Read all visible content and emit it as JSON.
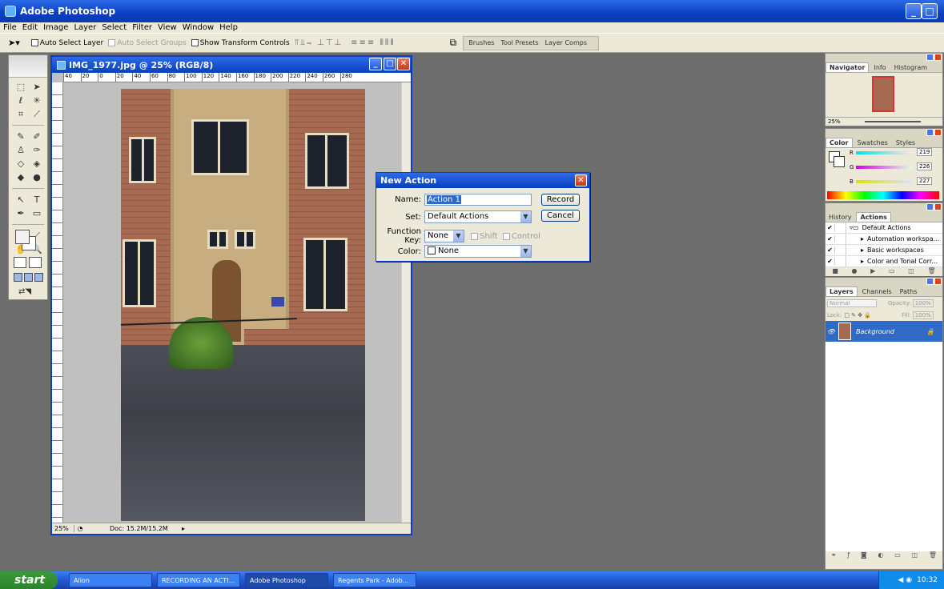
{
  "app": {
    "title": "Adobe Photoshop"
  },
  "menu": [
    "File",
    "Edit",
    "Image",
    "Layer",
    "Select",
    "Filter",
    "View",
    "Window",
    "Help"
  ],
  "options": {
    "auto_select_layer": "Auto Select Layer",
    "auto_select_groups": "Auto Select Groups",
    "show_transform": "Show Transform Controls",
    "palette_well_tabs": [
      "Brushes",
      "Tool Presets",
      "Layer Comps"
    ]
  },
  "document": {
    "title": "IMG_1977.jpg @ 25% (RGB/8)",
    "ruler_ticks": [
      "40",
      "20",
      "0",
      "20",
      "40",
      "60",
      "80",
      "100",
      "120",
      "140",
      "160",
      "180",
      "200",
      "220",
      "240",
      "260",
      "280"
    ],
    "zoom": "25%",
    "doc_size": "Doc: 15.2M/15.2M"
  },
  "dialog": {
    "title": "New Action",
    "name_label": "Name:",
    "name_value": "Action 1",
    "set_label": "Set:",
    "set_value": "Default Actions",
    "fkey_label": "Function Key:",
    "fkey_value": "None",
    "shift_label": "Shift",
    "control_label": "Control",
    "color_label": "Color:",
    "color_value": "None",
    "record": "Record",
    "cancel": "Cancel"
  },
  "navigator": {
    "tabs": [
      "Navigator",
      "Info",
      "Histogram"
    ],
    "zoom": "25%"
  },
  "color": {
    "tabs": [
      "Color",
      "Swatches",
      "Styles"
    ],
    "r_label": "R",
    "r_value": "219",
    "g_label": "G",
    "g_value": "226",
    "b_label": "B",
    "b_value": "227"
  },
  "actions": {
    "tabs": [
      "History",
      "Actions"
    ],
    "items": [
      "Default Actions",
      "Automation workspa...",
      "Basic workspaces",
      "Color and Tonal Corr..."
    ]
  },
  "layers": {
    "tabs": [
      "Layers",
      "Channels",
      "Paths"
    ],
    "blend_mode": "Normal",
    "opacity_label": "Opacity:",
    "opacity_value": "100%",
    "lock_label": "Lock:",
    "fill_label": "Fill:",
    "fill_value": "100%",
    "layer_name": "Background"
  },
  "taskbar": {
    "start": "start",
    "tasks": [
      "Alion",
      "RECORDING AN ACTI...",
      "Adobe Photoshop",
      "Regents Park - Adob..."
    ],
    "clock": "10:32"
  },
  "colors": {
    "title_blue": "#0a3fc0",
    "workspace_gray": "#6d6d6d",
    "selection_blue": "#316ac5"
  }
}
